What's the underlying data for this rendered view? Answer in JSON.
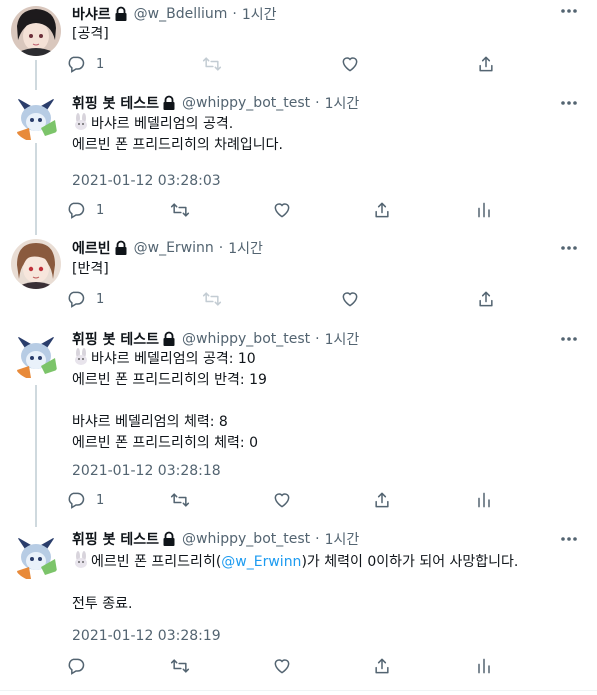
{
  "tweets": [
    {
      "name": "바샤르",
      "handle": "@w_Bdellium",
      "dot": "·",
      "time": "1시간",
      "text": "[공격]",
      "reply_count": "1"
    },
    {
      "name": "휘핑 봇 테스트",
      "handle": "@whippy_bot_test",
      "dot": "·",
      "time": "1시간",
      "text": "바샤르 베델리엄의 공격.\n에르빈 폰 프리드리히의 차례입니다.",
      "timestamp": "2021-01-12 03:28:03",
      "reply_count": "1"
    },
    {
      "name": "에르빈",
      "handle": "@w_Erwinn",
      "dot": "·",
      "time": "1시간",
      "text": "[반격]",
      "reply_count": "1"
    },
    {
      "name": "휘핑 봇 테스트",
      "handle": "@whippy_bot_test",
      "dot": "·",
      "time": "1시간",
      "text": "바샤르 베델리엄의 공격: 10\n에르빈 폰 프리드리히의 반격: 19\n\n바샤르 베델리엄의 체력: 8\n에르빈 폰 프리드리히의 체력: 0",
      "timestamp": "2021-01-12 03:28:18",
      "reply_count": "1"
    },
    {
      "name": "휘핑 봇 테스트",
      "handle": "@whippy_bot_test",
      "dot": "·",
      "time": "1시간",
      "text_before": "에르빈 폰 프리드리히(",
      "mention": "@w_Erwinn",
      "text_after": ")가 체력이 0이하가 되어 사망합니다.\n\n전투 종료.",
      "timestamp": "2021-01-12 03:28:19"
    }
  ],
  "icons": {
    "more": "more-icon",
    "reply": "reply-icon",
    "retweet": "retweet-icon",
    "like": "like-icon",
    "share": "share-icon",
    "analytics": "analytics-icon",
    "lock": "lock-icon",
    "rabbit": "rabbit-emoji"
  },
  "colors": {
    "text": "#0f1419",
    "secondary": "#536471",
    "link": "#1d9bf0",
    "thread_line": "#cfd9de"
  }
}
